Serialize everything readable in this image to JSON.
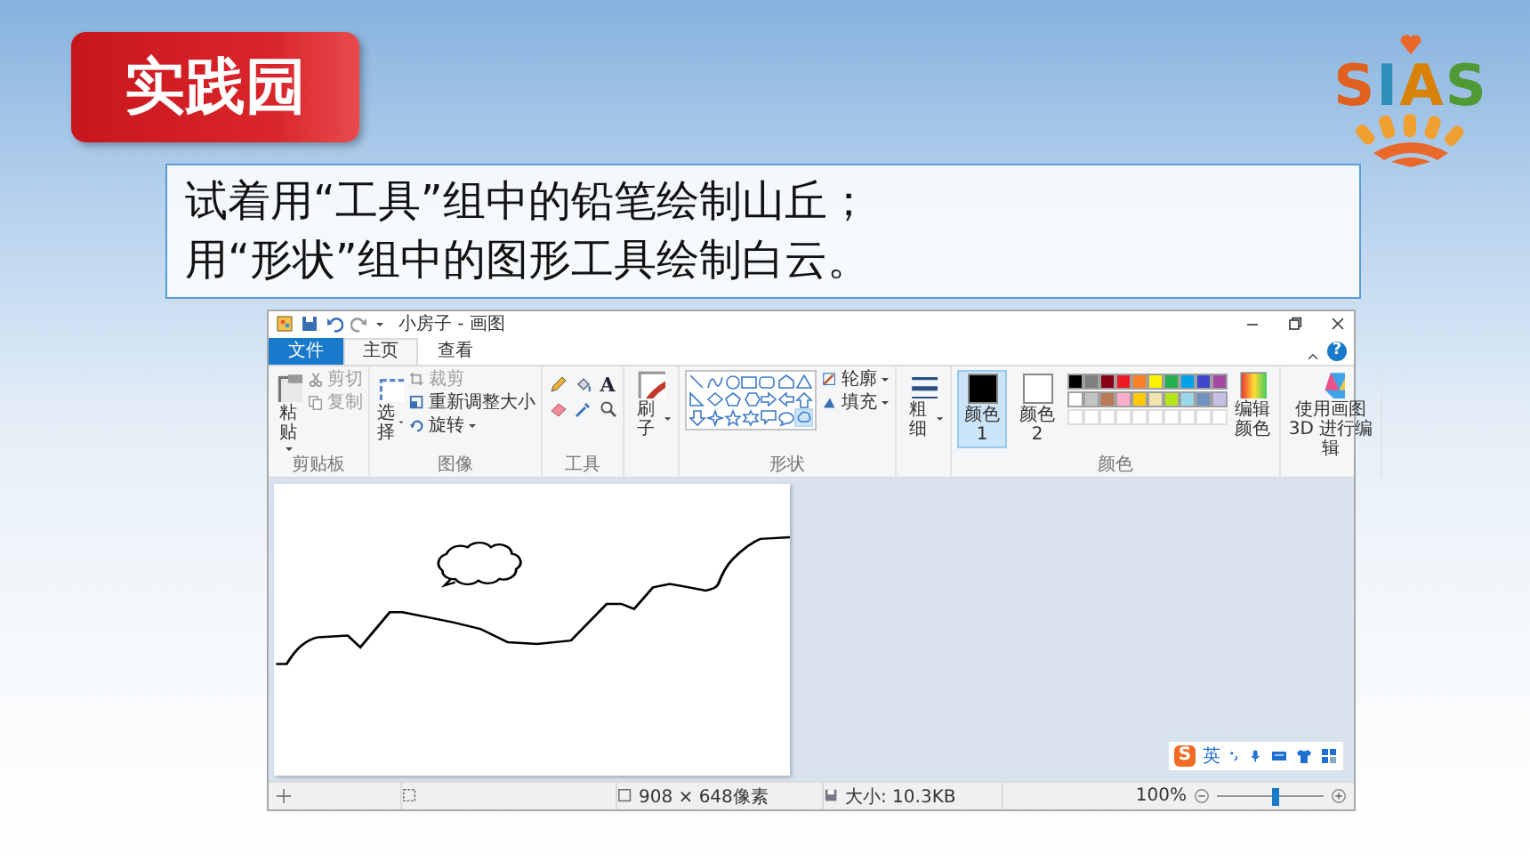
{
  "heading": {
    "text": "实践园"
  },
  "logo": {
    "text": "SIAS"
  },
  "task": {
    "lines": [
      "试着用“工具”组中的铅笔绘制山丘；",
      "用“形状”组中的图形工具绘制白云。"
    ]
  },
  "paint": {
    "title": "小房子 - 画图",
    "help": "?",
    "tabs": [
      {
        "label": "文件",
        "kind": "file",
        "selected": false
      },
      {
        "label": "主页",
        "kind": "tab",
        "selected": true
      },
      {
        "label": "查看",
        "kind": "tab",
        "selected": false
      }
    ],
    "ribbon": {
      "clipboard": {
        "label": "剪贴板",
        "paste": "粘贴",
        "items": [
          {
            "label": "剪切",
            "disabled": true
          },
          {
            "label": "复制",
            "disabled": true
          }
        ]
      },
      "image": {
        "label": "图像",
        "select": "选择",
        "items": [
          {
            "label": "裁剪",
            "disabled": true
          },
          {
            "label": "重新调整大小",
            "disabled": false
          },
          {
            "label": "旋转",
            "disabled": false
          }
        ]
      },
      "tools": {
        "label": "工具",
        "text_glyph": "A"
      },
      "brush": {
        "label": "刷子"
      },
      "shapes": {
        "label": "形状",
        "outline": "轮廓",
        "fill": "填充"
      },
      "size": {
        "label": "粗细"
      },
      "colors": {
        "label": "颜色",
        "color1": {
          "label": "颜色 1",
          "color": "#000000",
          "selected": true
        },
        "color2": {
          "label": "颜色 2",
          "color": "#ffffff",
          "selected": false
        },
        "palette": [
          {
            "color": "#000000"
          },
          {
            "color": "#7f7f7f"
          },
          {
            "color": "#880015"
          },
          {
            "color": "#ed1c24"
          },
          {
            "color": "#ff7f27"
          },
          {
            "color": "#fff200"
          },
          {
            "color": "#22b14c"
          },
          {
            "color": "#00a2e8"
          },
          {
            "color": "#3f48cc"
          },
          {
            "color": "#a349a4"
          },
          {
            "color": "#ffffff"
          },
          {
            "color": "#c3c3c3"
          },
          {
            "color": "#b97a57"
          },
          {
            "color": "#ffaec9"
          },
          {
            "color": "#ffc90e"
          },
          {
            "color": "#efe4b0"
          },
          {
            "color": "#b5e61d"
          },
          {
            "color": "#99d9ea"
          },
          {
            "color": "#7092be"
          },
          {
            "color": "#c8bfe7"
          }
        ],
        "edit": "编辑颜色"
      },
      "paint3d": {
        "label": "使用画图 3D 进行编辑"
      }
    },
    "ime": {
      "logo": "S",
      "mode": "英"
    },
    "status": {
      "dimensions": "908 × 648像素",
      "size": "大小: 10.3KB",
      "zoom": {
        "text": "100%",
        "level": 0.55
      }
    }
  }
}
